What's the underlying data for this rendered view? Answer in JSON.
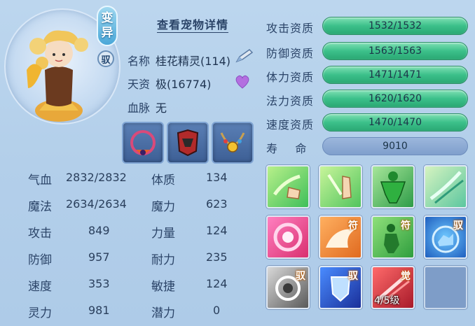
{
  "header": {
    "detail_link": "查看宠物详情"
  },
  "badges": {
    "variant_line1": "变",
    "variant_line2": "异",
    "ride": "驭"
  },
  "info": [
    {
      "label": "名称",
      "value": "桂花精灵(114)"
    },
    {
      "label": "天资",
      "value": "极(16774)"
    },
    {
      "label": "血脉",
      "value": "无"
    }
  ],
  "stats_left": [
    {
      "label": "气血",
      "value": "2832/2832"
    },
    {
      "label": "魔法",
      "value": "2634/2634"
    },
    {
      "label": "攻击",
      "value": "849"
    },
    {
      "label": "防御",
      "value": "957"
    },
    {
      "label": "速度",
      "value": "353"
    },
    {
      "label": "灵力",
      "value": "981"
    }
  ],
  "stats_right": [
    {
      "label": "体质",
      "value": "134"
    },
    {
      "label": "魔力",
      "value": "623"
    },
    {
      "label": "力量",
      "value": "124"
    },
    {
      "label": "耐力",
      "value": "235"
    },
    {
      "label": "敏捷",
      "value": "124"
    },
    {
      "label": "潜力",
      "value": "0"
    }
  ],
  "aptitudes": [
    {
      "label": "攻击资质",
      "value": "1532/1532"
    },
    {
      "label": "防御资质",
      "value": "1563/1563"
    },
    {
      "label": "体力资质",
      "value": "1471/1471"
    },
    {
      "label": "法力资质",
      "value": "1620/1620"
    },
    {
      "label": "速度资质",
      "value": "1470/1470"
    }
  ],
  "lifespan": {
    "label": "寿    命",
    "value": "9010"
  },
  "skills": {
    "tag_fu": "符",
    "tag_yu": "驭",
    "tag_jue": "觉",
    "level": "4/5级"
  },
  "colors": {
    "aptitude_bar": "#3cc08a",
    "lifespan_bar": "#8aa8d4",
    "background": "#b3cfea"
  }
}
